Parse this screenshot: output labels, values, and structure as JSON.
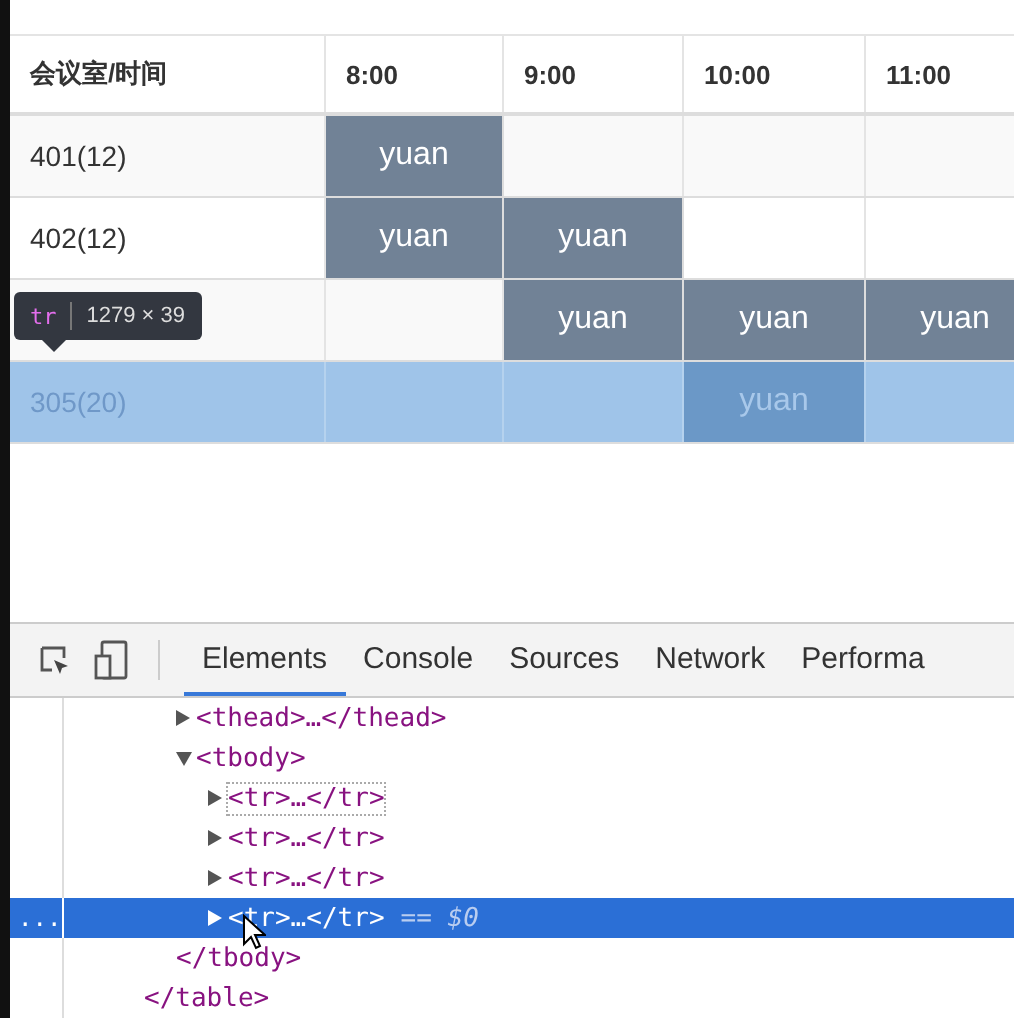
{
  "table": {
    "columns": [
      "会议室/时间",
      "8:00",
      "9:00",
      "10:00",
      "11:00"
    ],
    "rows": [
      {
        "room": "401(12)",
        "highlighted": false,
        "cells": [
          {
            "booked": true,
            "text": "yuan"
          },
          {
            "booked": false
          },
          {
            "booked": false
          },
          {
            "booked": false
          }
        ]
      },
      {
        "room": "402(12)",
        "highlighted": false,
        "cells": [
          {
            "booked": true,
            "text": "yuan"
          },
          {
            "booked": true,
            "text": "yuan"
          },
          {
            "booked": false
          },
          {
            "booked": false
          }
        ]
      },
      {
        "highlighted": false,
        "cells": [
          {
            "booked": false
          },
          {
            "booked": true,
            "text": "yuan"
          },
          {
            "booked": true,
            "text": "yuan"
          },
          {
            "booked": true,
            "text": "yuan"
          }
        ]
      },
      {
        "room": "305(20)",
        "highlighted": true,
        "cells": [
          {
            "booked": false
          },
          {
            "booked": false
          },
          {
            "booked": true,
            "text": "yuan"
          },
          {
            "booked": false
          }
        ]
      }
    ]
  },
  "tooltip": {
    "tag": "tr",
    "size": "1279 × 39"
  },
  "devtools": {
    "tabs": [
      {
        "label": "Elements",
        "selected": true
      },
      {
        "label": "Console",
        "selected": false
      },
      {
        "label": "Sources",
        "selected": false
      },
      {
        "label": "Network",
        "selected": false
      },
      {
        "label": "Performa",
        "selected": false
      }
    ],
    "tree": [
      {
        "close": "</table>",
        "children": [
          {
            "label": "<thead>…</thead>",
            "expanded": false
          },
          {
            "label": "<tbody>",
            "expanded": true,
            "close": "</tbody>",
            "children": [
              {
                "label": "<tr>…</tr>",
                "expanded": false,
                "hovered": true,
                "selected": false
              },
              {
                "label": "<tr>…</tr>",
                "expanded": false,
                "hovered": false,
                "selected": false
              },
              {
                "label": "<tr>…</tr>",
                "expanded": false,
                "hovered": false,
                "selected": false
              },
              {
                "label": "<tr>…</tr>",
                "expanded": false,
                "hovered": false,
                "selected": true,
                "suffix": "== $0",
                "gutter": "..."
              }
            ]
          }
        ]
      }
    ]
  }
}
